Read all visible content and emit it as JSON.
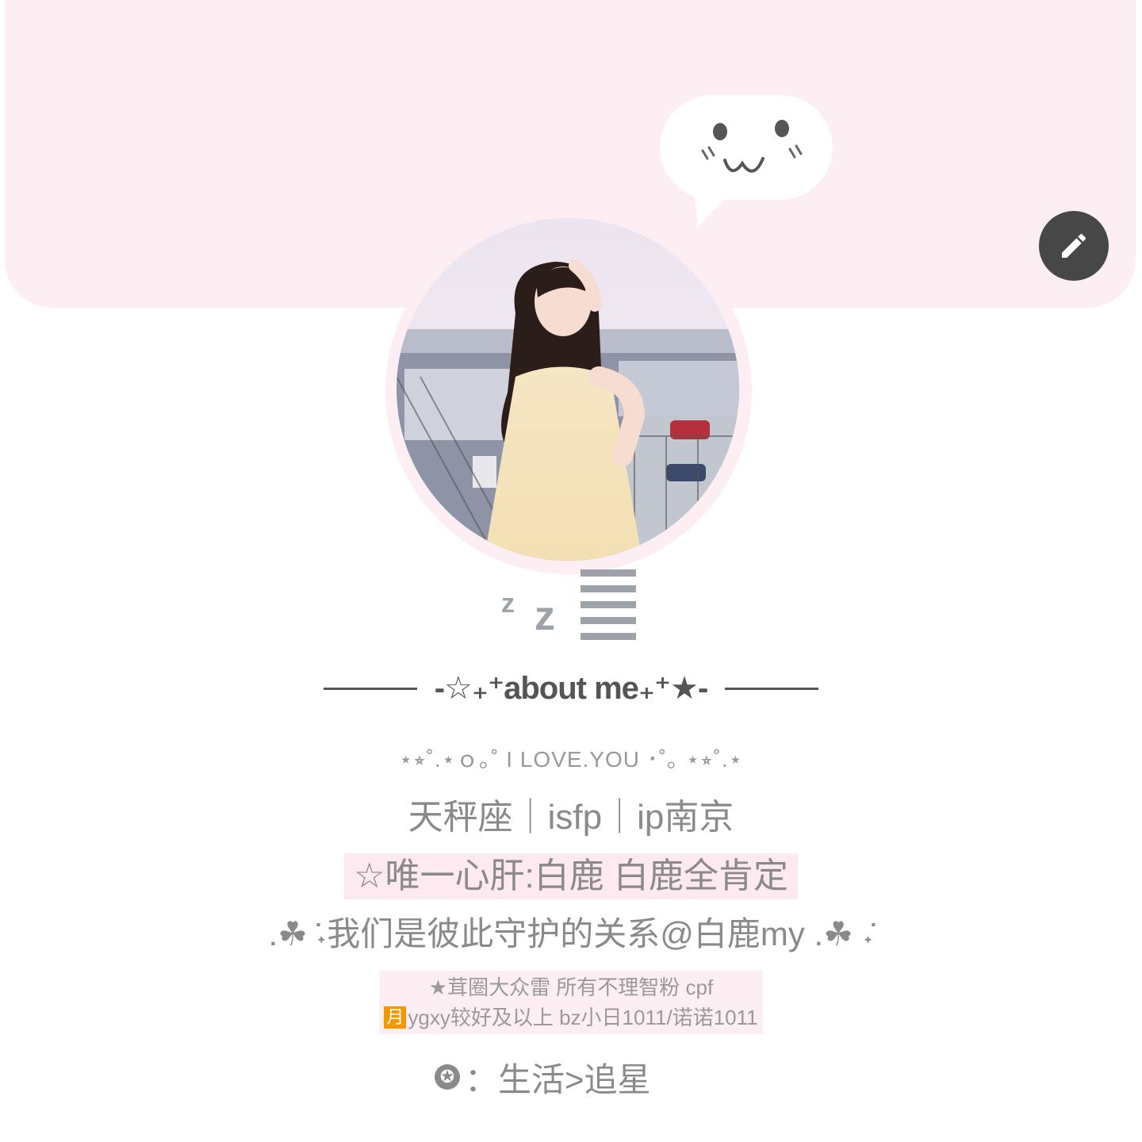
{
  "about": {
    "title": "-☆₊⁺about me₊⁺★-",
    "deco_line": "⋆⭒˚.⋆ｏ｡˚ I LOVE.YOU ･˚｡ ⋆⭒˚.⋆",
    "mbti_line": "天秤座｜isfp｜ip南京",
    "fan_line": "☆唯一心肝:白鹿  白鹿全肯定",
    "relation_line": ".☘︎ ݁˖我们是彼此守护的关系@白鹿my .☘︎ ݁˖",
    "rules_line1": "★茸圈大众雷 所有不理智粉 cpf",
    "rules_moon": "月",
    "rules_line2": "ygxy较好及以上 bz小日1011/诺诺1011",
    "life_badge": "✪",
    "life_line": "：生活>追星"
  },
  "icons": {
    "edit": "pencil-icon",
    "sleep": "sleep-zz-icon",
    "bubble": "kaomoji-face-icon"
  },
  "colors": {
    "banner": "#fdeef4",
    "text": "#8a8a8a",
    "edit_button": "#474747",
    "moon_badge": "#f39800"
  }
}
